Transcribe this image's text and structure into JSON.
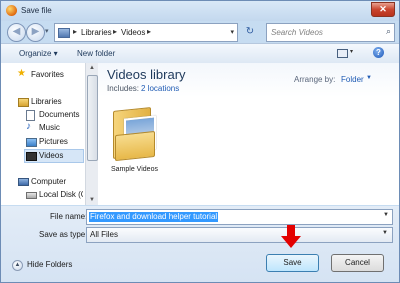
{
  "window": {
    "title": "Save file",
    "close_glyph": "✕"
  },
  "navigation": {
    "back_glyph": "◀",
    "forward_glyph": "▶",
    "address": {
      "crumbs": [
        "Libraries",
        "Videos"
      ]
    },
    "search": {
      "placeholder": "Search Videos"
    }
  },
  "toolbar": {
    "organize_label": "Organize ▾",
    "new_folder_label": "New folder",
    "help_glyph": "?"
  },
  "nav_pane": {
    "favorites": "Favorites",
    "libraries": "Libraries",
    "documents": "Documents",
    "music": "Music",
    "pictures": "Pictures",
    "videos": "Videos",
    "computer": "Computer",
    "local_disk": "Local Disk (C"
  },
  "library": {
    "title": "Videos library",
    "includes_label": "Includes:",
    "locations_link": "2 locations",
    "arrange_label": "Arrange by:",
    "arrange_value": "Folder",
    "items": [
      {
        "label": "Sample Videos",
        "icon": "folder-icon"
      }
    ]
  },
  "save_form": {
    "file_name_label": "File name:",
    "file_name_value": "Firefox and download helper tutorial",
    "save_as_type_label": "Save as type:",
    "save_as_type_value": "All Files",
    "hide_folders_label": "Hide Folders",
    "save_button": "Save",
    "cancel_button": "Cancel"
  },
  "colors": {
    "annotation_arrow": "#e30000",
    "selection": "#3399ff"
  }
}
